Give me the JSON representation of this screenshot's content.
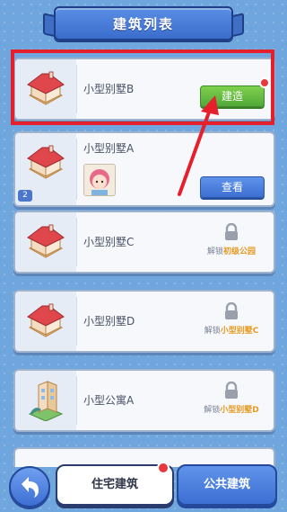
{
  "title": "建筑列表",
  "buildings": [
    {
      "name": "小型别墅B",
      "action": "建造"
    },
    {
      "name": "小型别墅A",
      "action": "查看",
      "count": "2"
    },
    {
      "name": "小型别墅C",
      "unlock_prefix": "解锁",
      "unlock_req": "初级公园"
    },
    {
      "name": "小型别墅D",
      "unlock_prefix": "解锁",
      "unlock_req": "小型别墅C"
    },
    {
      "name": "小型公寓A",
      "unlock_prefix": "解锁",
      "unlock_req": "小型别墅D"
    }
  ],
  "tabs": {
    "residential": "住宅建筑",
    "public": "公共建筑"
  },
  "colors": {
    "highlight": "#e51f2b",
    "accent_green": "#52a93a",
    "accent_blue": "#3c6fd2",
    "unlock_req": "#e79a21"
  }
}
